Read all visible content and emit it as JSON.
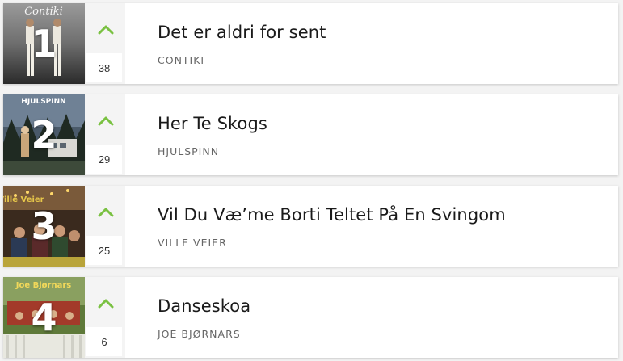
{
  "entries": [
    {
      "rank": "1",
      "title": "Det er aldri for sent",
      "artist": "CONTIKI",
      "prev": "38",
      "trend_icon": "chevron-up-icon",
      "cover_text": "Contiki"
    },
    {
      "rank": "2",
      "title": "Her Te Skogs",
      "artist": "HJULSPINN",
      "prev": "29",
      "trend_icon": "chevron-up-icon",
      "cover_text": "HJULSPINN"
    },
    {
      "rank": "3",
      "title": "Vil Du Væ’me Borti Teltet På En Svingom",
      "artist": "VILLE VEIER",
      "prev": "25",
      "trend_icon": "chevron-up-icon",
      "cover_text": "Ville Veier"
    },
    {
      "rank": "4",
      "title": "Danseskoa",
      "artist": "JOE BJØRNARS",
      "prev": "6",
      "trend_icon": "chevron-up-icon",
      "cover_text": "Joe Bjørnars"
    }
  ],
  "colors": {
    "trend_up": "#7ac142",
    "card_bg": "#ffffff",
    "side_bg": "#f4f4f4",
    "page_bg": "#f3f3f3"
  }
}
